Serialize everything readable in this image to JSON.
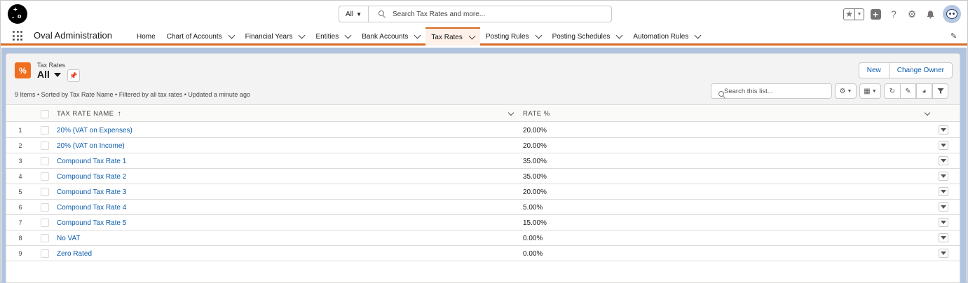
{
  "header": {
    "search_scope": "All",
    "search_placeholder": "Search Tax Rates and more..."
  },
  "nav": {
    "app_name": "Oval Administration",
    "items": [
      {
        "label": "Home",
        "has_menu": false
      },
      {
        "label": "Chart of Accounts",
        "has_menu": true
      },
      {
        "label": "Financial Years",
        "has_menu": true
      },
      {
        "label": "Entities",
        "has_menu": true
      },
      {
        "label": "Bank Accounts",
        "has_menu": true
      },
      {
        "label": "Tax Rates",
        "has_menu": true,
        "active": true
      },
      {
        "label": "Posting Rules",
        "has_menu": true
      },
      {
        "label": "Posting Schedules",
        "has_menu": true
      },
      {
        "label": "Automation Rules",
        "has_menu": true
      }
    ]
  },
  "list": {
    "object_label": "Tax Rates",
    "view_name": "All",
    "meta": "9 Items • Sorted by Tax Rate Name • Filtered by all tax rates • Updated a minute ago",
    "buttons": {
      "new": "New",
      "change_owner": "Change Owner"
    },
    "search_placeholder": "Search this list...",
    "columns": {
      "name": "TAX RATE NAME",
      "rate": "RATE %"
    },
    "rows": [
      {
        "num": "1",
        "name": "20% (VAT on Expenses)",
        "rate": "20.00%"
      },
      {
        "num": "2",
        "name": "20% (VAT on Income)",
        "rate": "20.00%"
      },
      {
        "num": "3",
        "name": "Compound Tax Rate 1",
        "rate": "35.00%"
      },
      {
        "num": "4",
        "name": "Compound Tax Rate 2",
        "rate": "35.00%"
      },
      {
        "num": "5",
        "name": "Compound Tax Rate 3",
        "rate": "20.00%"
      },
      {
        "num": "6",
        "name": "Compound Tax Rate 4",
        "rate": "5.00%"
      },
      {
        "num": "7",
        "name": "Compound Tax Rate 5",
        "rate": "15.00%"
      },
      {
        "num": "8",
        "name": "No VAT",
        "rate": "0.00%"
      },
      {
        "num": "9",
        "name": "Zero Rated",
        "rate": "0.00%"
      }
    ]
  },
  "colors": {
    "brand_orange": "#d86a22",
    "link_blue": "#0b5cab",
    "background_blue": "#b0c4df"
  }
}
